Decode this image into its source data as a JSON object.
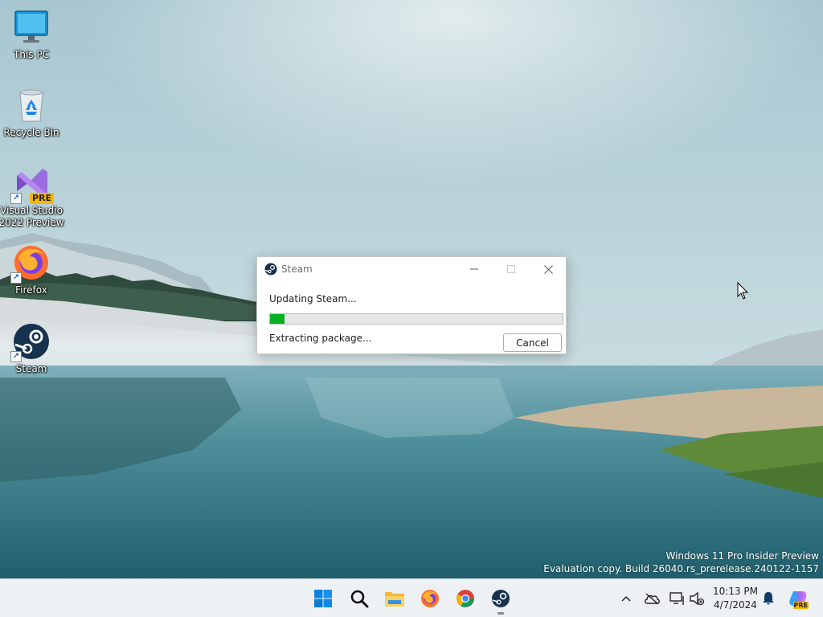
{
  "desktop": {
    "icons": [
      {
        "label": "This PC"
      },
      {
        "label": "Recycle Bin"
      },
      {
        "label": "Visual Studio\n2022 Preview",
        "badge": "PRE"
      },
      {
        "label": "Firefox"
      },
      {
        "label": "Steam"
      }
    ]
  },
  "watermark": {
    "line1": "Windows 11 Pro Insider Preview",
    "line2": "Evaluation copy. Build 26040.rs_prerelease.240122-1157"
  },
  "dialog": {
    "title": "Steam",
    "status": "Updating Steam...",
    "substatus": "Extracting package...",
    "progress_percent": 5,
    "cancel_label": "Cancel",
    "progress_color": "#06b025"
  },
  "taskbar": {
    "apps": [
      "start-icon",
      "search-icon",
      "file-explorer-icon",
      "firefox-icon",
      "chrome-icon",
      "steam-icon"
    ],
    "tray": [
      "chevron-up-icon",
      "onedrive-icon",
      "network-icon",
      "volume-muted-icon",
      "notification-bell-icon",
      "copilot-icon"
    ],
    "copilot_badge": "PRE",
    "clock": {
      "time": "10:13 PM",
      "date": "4/7/2024"
    }
  },
  "colors": {
    "accent": "#0078d4",
    "taskbar_bg": "#eef1f4"
  }
}
